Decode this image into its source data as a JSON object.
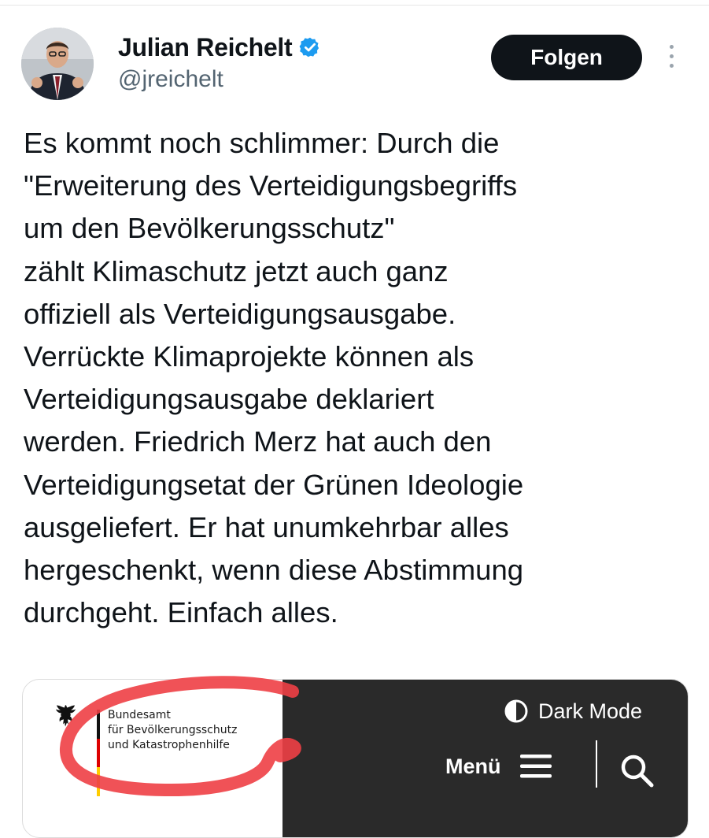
{
  "author": {
    "display_name": "Julian Reichelt",
    "handle": "@jreichelt",
    "verified": true,
    "avatar_icon": "avatar-photo"
  },
  "actions": {
    "follow_label": "Folgen",
    "more_icon": "more-vertical-icon"
  },
  "tweet": {
    "lines": [
      "Es kommt noch schlimmer: Durch die",
      "\"Erweiterung des Verteidigungsbegriffs",
      "um den Bevölkerungsschutz\"",
      "zählt Klimaschutz jetzt auch ganz",
      "offiziell als Verteidigungsausgabe.",
      "Verrückte Klimaprojekte können als",
      "Verteidigungsausgabe deklariert",
      "werden. Friedrich Merz hat auch den",
      "Verteidigungsetat der Grünen Ideologie",
      "ausgeliefert. Er hat unumkehrbar alles",
      "hergeschenkt, wenn diese Abstimmung",
      "durchgeht. Einfach alles."
    ]
  },
  "media": {
    "agency_lines": [
      "Bundesamt",
      "für Bevölkerungsschutz",
      "und Katastrophenhilfe"
    ],
    "dark_mode_label": "Dark Mode",
    "menu_label": "Menü",
    "icons": [
      "eagle-icon",
      "halfmoon-icon",
      "hamburger-icon",
      "search-icon"
    ]
  },
  "colors": {
    "follow_bg": "#0f1419",
    "handle": "#536471",
    "verified": "#1d9bf0",
    "dark_header": "#2a2a2a",
    "scribble": "#ee3f45"
  }
}
